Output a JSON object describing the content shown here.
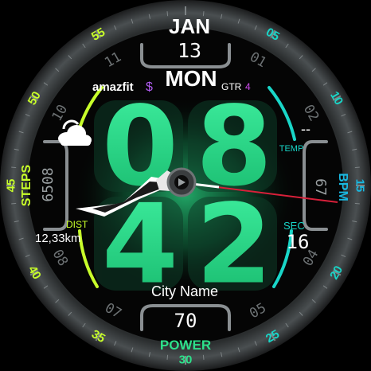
{
  "date": {
    "month": "JAN",
    "day": "13",
    "weekday": "MON"
  },
  "brand": {
    "logo": "amazfit",
    "model": "GTR",
    "model_num": "4"
  },
  "time": {
    "hours": "08",
    "minutes": "42"
  },
  "weather": {
    "icon": "cloud-icon",
    "temp_value": "--",
    "temp_label": "TEMP"
  },
  "steps": {
    "label": "STEPS",
    "value": "6508"
  },
  "heart": {
    "label": "BPM",
    "value": "67"
  },
  "distance": {
    "label": "DIST",
    "value": "12,33km"
  },
  "seconds": {
    "label": "SEC",
    "value": "16"
  },
  "city": {
    "name": "City Name"
  },
  "power": {
    "label": "POWER",
    "value": "70"
  },
  "bezel_numbers": [
    "55",
    "05",
    "10",
    "15",
    "20",
    "25",
    "30",
    "35",
    "40",
    "45",
    "50"
  ],
  "dial_numbers": [
    "11",
    "01",
    "02",
    "04",
    "05",
    "07",
    "08",
    "10"
  ],
  "colors": {
    "accent_green": "#2de08a",
    "accent_cyan": "#19d6c8",
    "accent_lime": "#c8ff2a",
    "second_hand": "#d8203a"
  }
}
